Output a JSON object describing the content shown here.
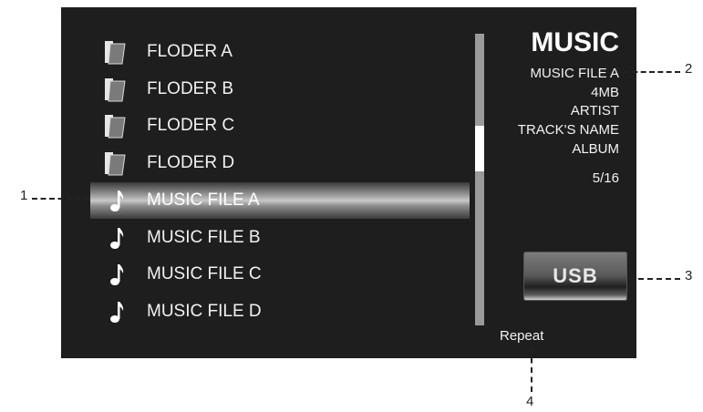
{
  "browser": {
    "rows": [
      {
        "type": "folder",
        "label": "FLODER A",
        "icon": "folder-icon"
      },
      {
        "type": "folder",
        "label": "FLODER B",
        "icon": "folder-icon"
      },
      {
        "type": "folder",
        "label": "FLODER C",
        "icon": "folder-icon"
      },
      {
        "type": "folder",
        "label": "FLODER D",
        "icon": "folder-icon"
      },
      {
        "type": "music",
        "label": "MUSIC FILE A",
        "icon": "music-note-icon",
        "selected": true
      },
      {
        "type": "music",
        "label": "MUSIC FILE B",
        "icon": "music-note-icon"
      },
      {
        "type": "music",
        "label": "MUSIC FILE C",
        "icon": "music-note-icon"
      },
      {
        "type": "music",
        "label": "MUSIC FILE D",
        "icon": "music-note-icon"
      }
    ]
  },
  "info": {
    "title": "MUSIC",
    "file_name": "MUSIC FILE A",
    "size": "4MB",
    "artist": "ARTIST",
    "track": "TRACK'S NAME",
    "album": "ALBUM",
    "position": "5/16"
  },
  "source_button": "USB",
  "repeat_label": "Repeat",
  "callouts": [
    "1",
    "2",
    "3",
    "4"
  ],
  "colors": {
    "screen_bg": "#1e1e1e",
    "text": "#f2f2f2",
    "scrollbar": "#9a9a9a"
  }
}
